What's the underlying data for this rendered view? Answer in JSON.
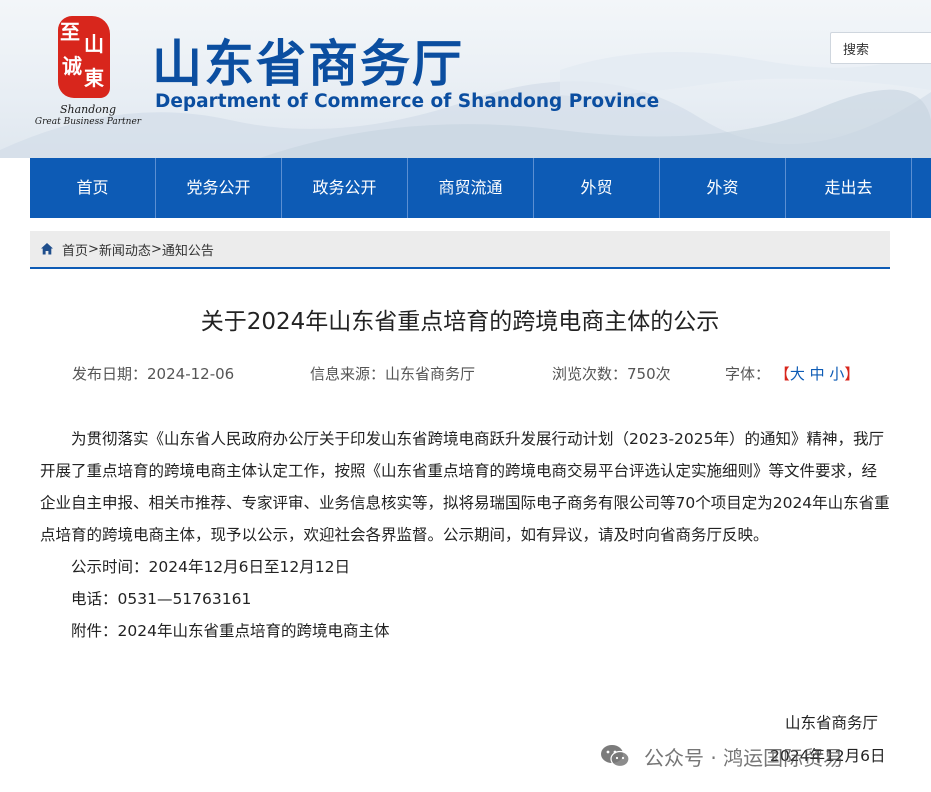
{
  "header": {
    "seal_chars": [
      "至",
      "山",
      "诚",
      "東"
    ],
    "logo_script_line1": "Shandong",
    "logo_script_line2": "Great Business Partner",
    "title": "山东省商务厅",
    "subtitle": "Department of Commerce of Shandong Province",
    "search_placeholder": "搜索"
  },
  "nav": {
    "items": [
      "首页",
      "党务公开",
      "政务公开",
      "商贸流通",
      "外贸",
      "外资",
      "走出去"
    ]
  },
  "breadcrumb": {
    "items": [
      "首页",
      "新闻动态",
      "通知公告"
    ],
    "separator": ">"
  },
  "article": {
    "title": "关于2024年山东省重点培育的跨境电商主体的公示",
    "meta": {
      "date_label": "发布日期：",
      "date": "2024-12-06",
      "source_label": "信息来源：",
      "source": "山东省商务厅",
      "views_label": "浏览次数：",
      "views": "750次",
      "font_label": "字体：",
      "font_open": "【",
      "font_large": "大",
      "font_medium": "中",
      "font_small": "小",
      "font_close": "】"
    },
    "paragraph": "为贯彻落实《山东省人民政府办公厅关于印发山东省跨境电商跃升发展行动计划（2023-2025年）的通知》精神，我厅开展了重点培育的跨境电商主体认定工作，按照《山东省重点培育的跨境电商交易平台评选认定实施细则》等文件要求，经企业自主申报、相关市推荐、专家评审、业务信息核实等，拟将易瑞国际电子商务有限公司等70个项目定为2024年山东省重点培育的跨境电商主体，现予以公示，欢迎社会各界监督。公示期间，如有异议，请及时向省商务厅反映。",
    "period": "公示时间：2024年12月6日至12月12日",
    "phone": "电话：0531—51763161",
    "attachment_label": "附件：",
    "attachment": "2024年山东省重点培育的跨境电商主体",
    "signature": "山东省商务厅",
    "sign_date": "2024年12月6日"
  },
  "watermark": {
    "text": "公众号 · 鸿运国际贸易"
  }
}
